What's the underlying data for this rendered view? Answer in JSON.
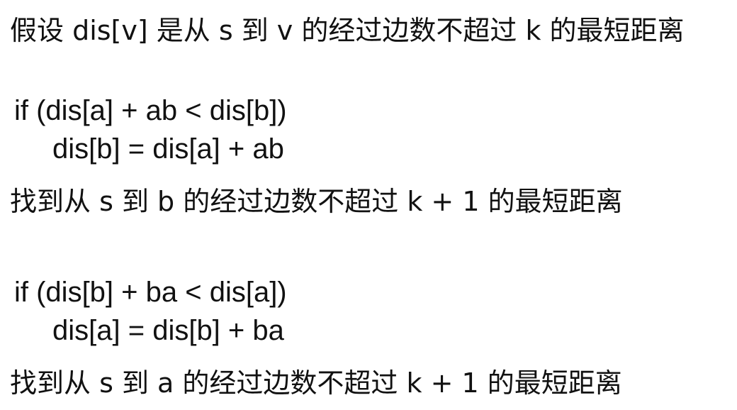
{
  "lines": [
    "假设 dis[v] 是从 s 到 v 的经过边数不超过 k 的最短距离",
    "if (dis[a] + ab < dis[b])",
    "dis[b] = dis[a] + ab",
    "找到从 s 到 b 的经过边数不超过 k + 1 的最短距离",
    "if (dis[b] + ba < dis[a])",
    "dis[a] = dis[b] + ba",
    "找到从 s 到 a 的经过边数不超过 k + 1 的最短距离"
  ]
}
